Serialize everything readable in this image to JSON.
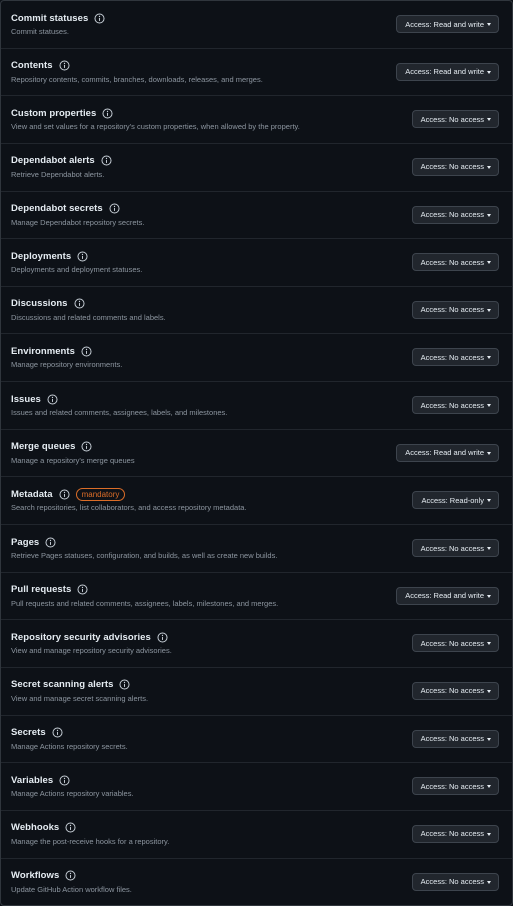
{
  "permissions": [
    {
      "name": "Commit statuses",
      "description": "Commit statuses.",
      "access": "Access: Read and write"
    },
    {
      "name": "Contents",
      "description": "Repository contents, commits, branches, downloads, releases, and merges.",
      "access": "Access: Read and write"
    },
    {
      "name": "Custom properties",
      "description": "View and set values for a repository's custom properties, when allowed by the property.",
      "access": "Access: No access"
    },
    {
      "name": "Dependabot alerts",
      "description": "Retrieve Dependabot alerts.",
      "access": "Access: No access"
    },
    {
      "name": "Dependabot secrets",
      "description": "Manage Dependabot repository secrets.",
      "access": "Access: No access"
    },
    {
      "name": "Deployments",
      "description": "Deployments and deployment statuses.",
      "access": "Access: No access"
    },
    {
      "name": "Discussions",
      "description": "Discussions and related comments and labels.",
      "access": "Access: No access"
    },
    {
      "name": "Environments",
      "description": "Manage repository environments.",
      "access": "Access: No access"
    },
    {
      "name": "Issues",
      "description": "Issues and related comments, assignees, labels, and milestones.",
      "access": "Access: No access"
    },
    {
      "name": "Merge queues",
      "description": "Manage a repository's merge queues",
      "access": "Access: Read and write"
    },
    {
      "name": "Metadata",
      "description": "Search repositories, list collaborators, and access repository metadata.",
      "access": "Access: Read-only",
      "badge": "mandatory"
    },
    {
      "name": "Pages",
      "description": "Retrieve Pages statuses, configuration, and builds, as well as create new builds.",
      "access": "Access: No access"
    },
    {
      "name": "Pull requests",
      "description": "Pull requests and related comments, assignees, labels, milestones, and merges.",
      "access": "Access: Read and write"
    },
    {
      "name": "Repository security advisories",
      "description": "View and manage repository security advisories.",
      "access": "Access: No access"
    },
    {
      "name": "Secret scanning alerts",
      "description": "View and manage secret scanning alerts.",
      "access": "Access: No access"
    },
    {
      "name": "Secrets",
      "description": "Manage Actions repository secrets.",
      "access": "Access: No access"
    },
    {
      "name": "Variables",
      "description": "Manage Actions repository variables.",
      "access": "Access: No access"
    },
    {
      "name": "Webhooks",
      "description": "Manage the post-receive hooks for a repository.",
      "access": "Access: No access"
    },
    {
      "name": "Workflows",
      "description": "Update GitHub Action workflow files.",
      "access": "Access: No access"
    }
  ],
  "colors": {
    "background": "#0d1117",
    "border": "#21262d",
    "button_bg": "#21262d",
    "text": "#e6edf3",
    "muted": "#8d96a0",
    "badge": "#db6d28"
  },
  "icons": {
    "info": "info-icon",
    "caret": "caret-down-icon"
  }
}
